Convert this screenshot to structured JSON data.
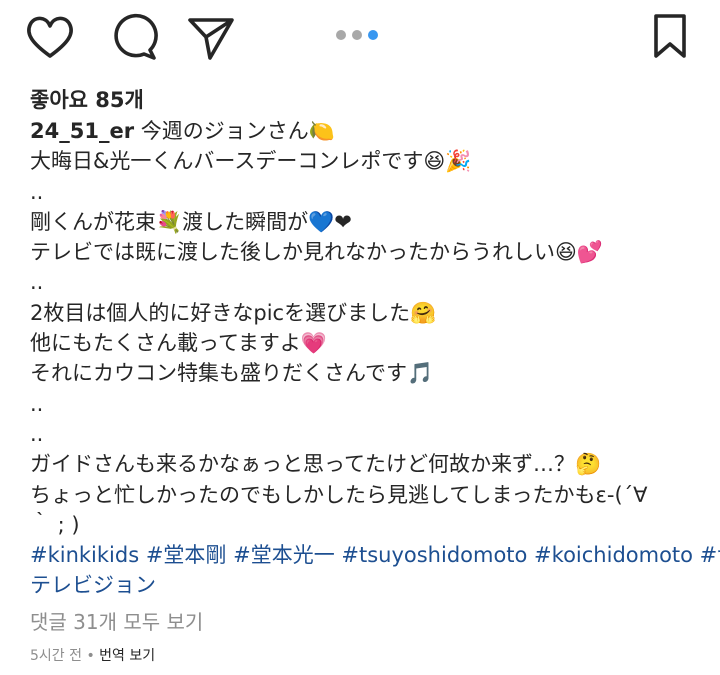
{
  "actions": {
    "icons": [
      "heart-icon",
      "comment-icon",
      "share-icon",
      "bookmark-icon"
    ],
    "carousel_dots": 3,
    "active_dot": 2,
    "accent_color": "#3897f0"
  },
  "likes": "좋아요 85개",
  "caption": {
    "username": "24_51_er",
    "lines": [
      " 今週のジョンさん🍋",
      "大晦日&光一くんバースデーコンレポです😆🎉",
      "..",
      "剛くんが花束💐渡した瞬間が💙❤",
      "テレビでは既に渡した後しか見れなかったからうれしい😆💕",
      "..",
      "2枚目は個人的に好きなpicを選びました🤗",
      "他にもたくさん載ってますよ💗",
      "それにカウコン特集も盛りだくさんです🎵",
      "..",
      "..",
      "ガイドさんも来るかなぁっと思ってたけど何故か来ず…？🤔",
      "ちょっと忙しかったのでもしかしたら見逃してしまったかもε-(´∀",
      "｀ ; )"
    ],
    "hashtags_line1": "#kinkikids #堂本剛 #堂本光一 #tsuyoshidomoto #koichidomoto #ザ",
    "hashtags_line2": "テレビジョン"
  },
  "view_comments": "댓글 31개 모두 보기",
  "time": "5시간 전",
  "separator": " • ",
  "translate": "번역 보기"
}
